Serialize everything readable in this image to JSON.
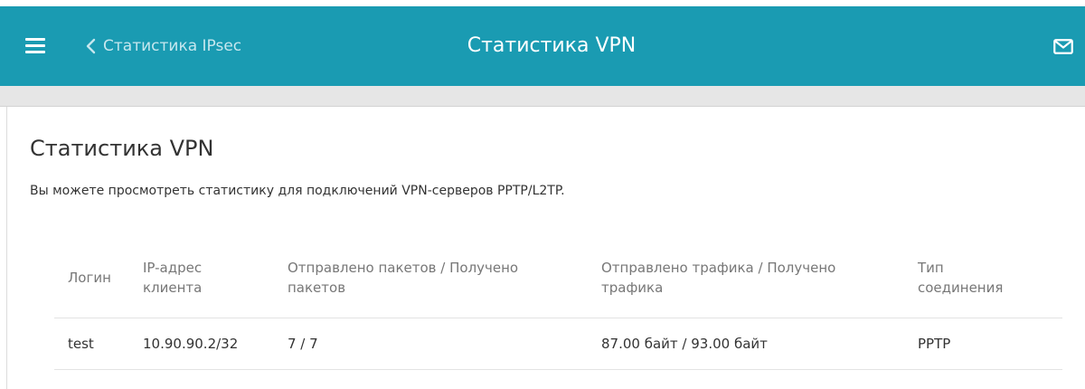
{
  "header": {
    "back_label": "Статистика IPsec",
    "title": "Статистика VPN",
    "menu_icon": "hamburger-menu-icon",
    "back_icon": "chevron-left-icon",
    "mail_icon": "mail-envelope-icon",
    "accent_color": "#1a9bb2"
  },
  "main": {
    "title": "Статистика VPN",
    "description": "Вы можете просмотреть статистику для подключений VPN-серверов PPTP/L2TP.",
    "table": {
      "columns": [
        {
          "line1": "Логин",
          "line2": ""
        },
        {
          "line1": "IP-адрес",
          "line2": "клиента"
        },
        {
          "line1": "Отправлено пакетов / Получено",
          "line2": "пакетов"
        },
        {
          "line1": "Отправлено трафика / Получено",
          "line2": "трафика"
        },
        {
          "line1": "Тип",
          "line2": "соединения"
        }
      ],
      "rows": [
        [
          "test",
          "10.90.90.2/32",
          "7 / 7",
          "87.00 байт / 93.00 байт",
          "PPTP"
        ]
      ]
    }
  }
}
